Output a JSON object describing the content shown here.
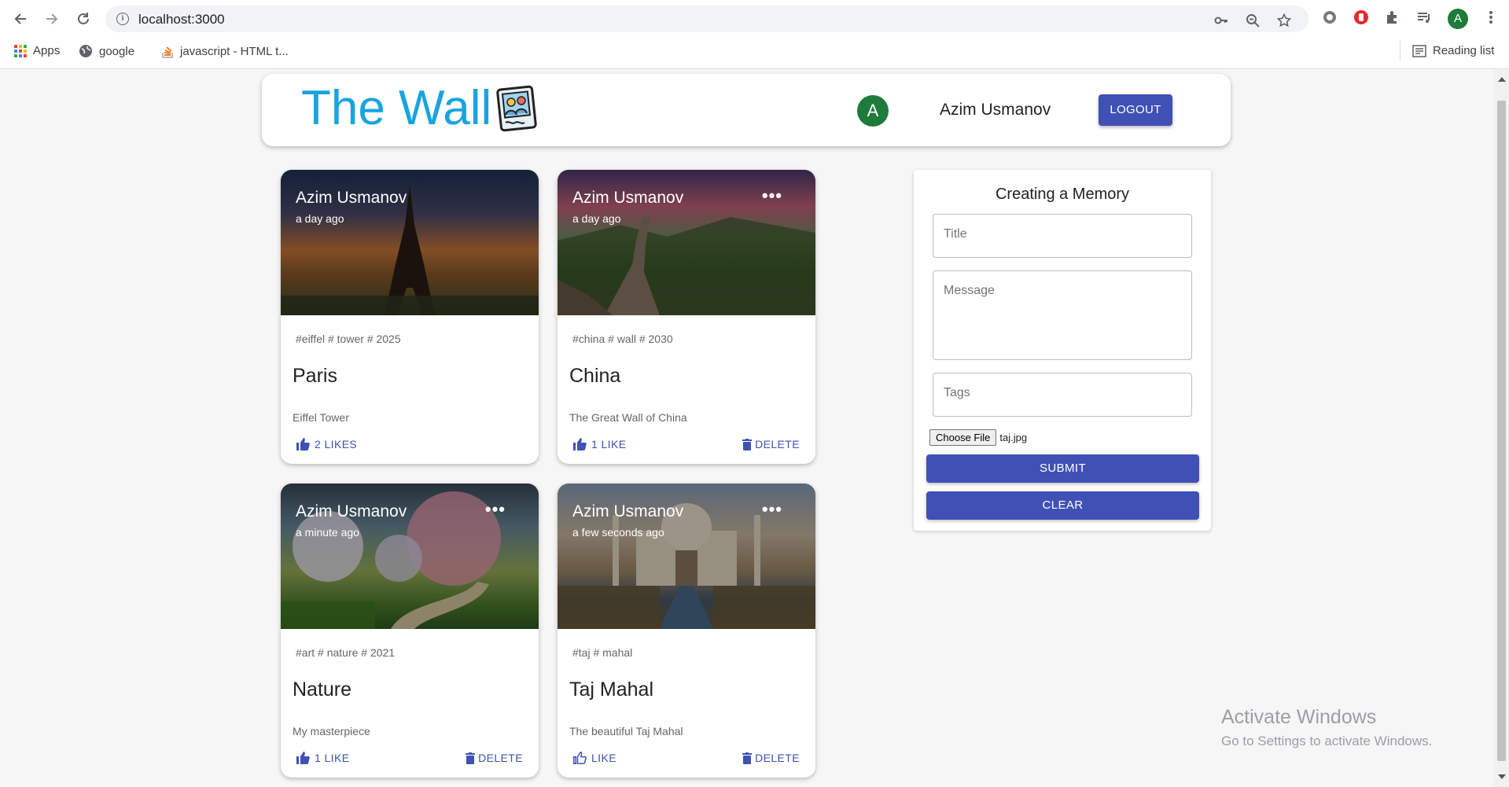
{
  "browser": {
    "url": "localhost:3000",
    "bookmarks": [
      {
        "label": "Apps",
        "icon": "apps-grid-icon"
      },
      {
        "label": "google",
        "icon": "globe-icon"
      },
      {
        "label": "javascript - HTML t...",
        "icon": "stackoverflow-icon"
      }
    ],
    "reading_list": "Reading list",
    "profile_initial": "A"
  },
  "app": {
    "brand": "The Wall",
    "user_initial": "A",
    "user_name": "Azim Usmanov",
    "logout_label": "LOGOUT"
  },
  "posts": [
    {
      "author": "Azim Usmanov",
      "time": "a day ago",
      "tags": "#eiffel # tower # 2025",
      "title": "Paris",
      "message": "Eiffel Tower",
      "like_label": "2 LIKES",
      "delete_label": "",
      "show_more": false
    },
    {
      "author": "Azim Usmanov",
      "time": "a day ago",
      "tags": "#china # wall # 2030",
      "title": "China",
      "message": "The Great Wall of China",
      "like_label": "1 LIKE",
      "delete_label": "DELETE",
      "show_more": true
    },
    {
      "author": "Azim Usmanov",
      "time": "a minute ago",
      "tags": "#art # nature # 2021",
      "title": "Nature",
      "message": "My masterpiece",
      "like_label": "1 LIKE",
      "delete_label": "DELETE",
      "show_more": true
    },
    {
      "author": "Azim Usmanov",
      "time": "a few seconds ago",
      "tags": "#taj # mahal",
      "title": "Taj Mahal",
      "message": "The beautiful Taj Mahal",
      "like_label": "LIKE",
      "delete_label": "DELETE",
      "show_more": true
    }
  ],
  "form": {
    "heading": "Creating a Memory",
    "title_placeholder": "Title",
    "message_placeholder": "Message",
    "tags_placeholder": "Tags",
    "file_button": "Choose File",
    "file_name": "taj.jpg",
    "submit_label": "SUBMIT",
    "clear_label": "CLEAR"
  },
  "watermark": {
    "line1": "Activate Windows",
    "line2": "Go to Settings to activate Windows."
  },
  "colors": {
    "primary": "#3f51b5",
    "brand": "#18a4e0",
    "avatar": "#1e7b3a"
  }
}
